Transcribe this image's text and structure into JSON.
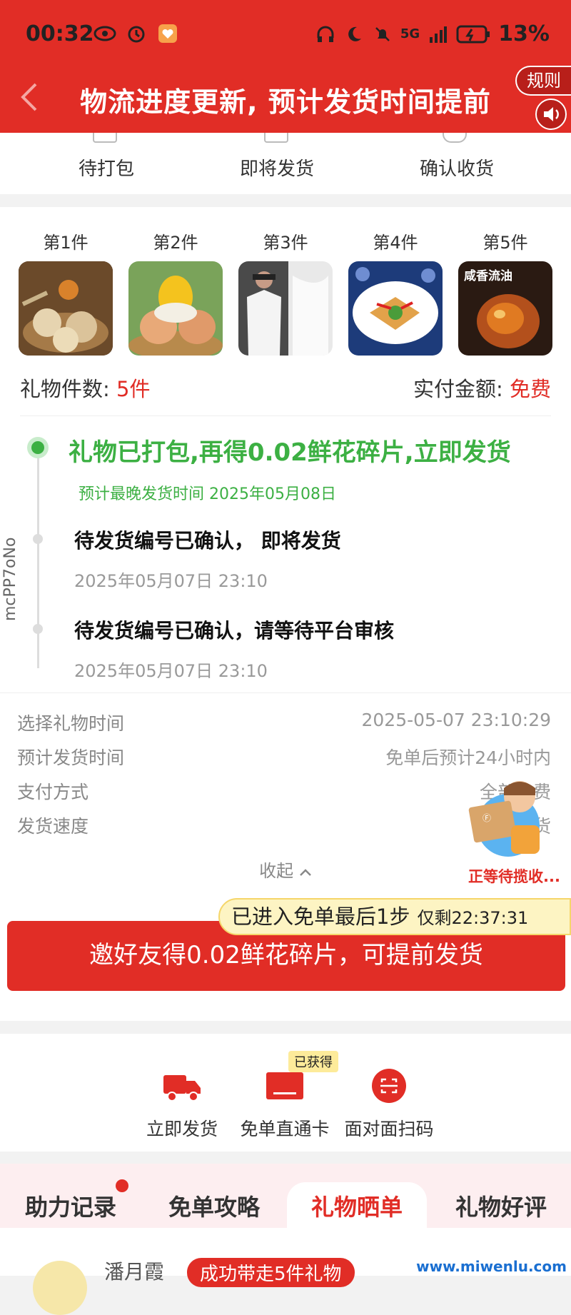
{
  "status_bar": {
    "time": "00:32",
    "battery": "13%",
    "network": "5G"
  },
  "header": {
    "title": "物流进度更新, 预计发货时间提前",
    "rules_label": "规则"
  },
  "steps": [
    "待打包",
    "即将发货",
    "确认收货"
  ],
  "items": [
    {
      "label": "第1件",
      "image": "eggs-basket"
    },
    {
      "label": "第2件",
      "image": "salted-eggs"
    },
    {
      "label": "第3件",
      "image": "white-tshirt"
    },
    {
      "label": "第4件",
      "image": "egg-dish"
    },
    {
      "label": "第5件",
      "image": "salted-egg-promo",
      "overlay": "咸香流油"
    }
  ],
  "summary": {
    "count_label": "礼物件数: ",
    "count_value": "5件",
    "paid_label": "实付金额: ",
    "paid_value": "免费"
  },
  "watermark": "mcPP7oNo",
  "timeline": {
    "main": "礼物已打包,再得0.02鲜花碎片,立即发货",
    "main_sub": "预计最晚发货时间 2025年05月08日",
    "entries": [
      {
        "text": "待发货编号已确认， 即将发货",
        "time": "2025年05月07日 23:10"
      },
      {
        "text": "待发货编号已确认，请等待平台审核",
        "time": "2025年05月07日 23:10"
      }
    ]
  },
  "info": [
    {
      "label": "选择礼物时间",
      "value": "2025-05-07 23:10:29"
    },
    {
      "label": "预计发货时间",
      "value": "免单后预计24小时内"
    },
    {
      "label": "支付方式",
      "value": "全部免费"
    },
    {
      "label": "发货速度",
      "value": "优先发货"
    }
  ],
  "collapse_label": "收起",
  "mascot_label": "正等待揽收...",
  "tip": {
    "text": "已进入免单最后1步",
    "countdown": "仅剩22:37:31"
  },
  "main_button": "邀好友得0.02鲜花碎片，可提前发货",
  "actions": [
    {
      "label": "立即发货",
      "icon": "truck-icon"
    },
    {
      "label": "免单直通卡",
      "icon": "card-icon",
      "badge": "已获得"
    },
    {
      "label": "面对面扫码",
      "icon": "scan-icon"
    }
  ],
  "tabs": [
    "助力记录",
    "免单攻略",
    "礼物晒单",
    "礼物好评"
  ],
  "active_tab": "礼物晒单",
  "footer": {
    "user": "潘月霞",
    "pill": "成功带走5件礼物",
    "site": "www.miwenlu.com"
  },
  "colors": {
    "brand_red": "#e12d26",
    "success_green": "#3cb043",
    "tip_yellow": "#fdf4c3"
  }
}
